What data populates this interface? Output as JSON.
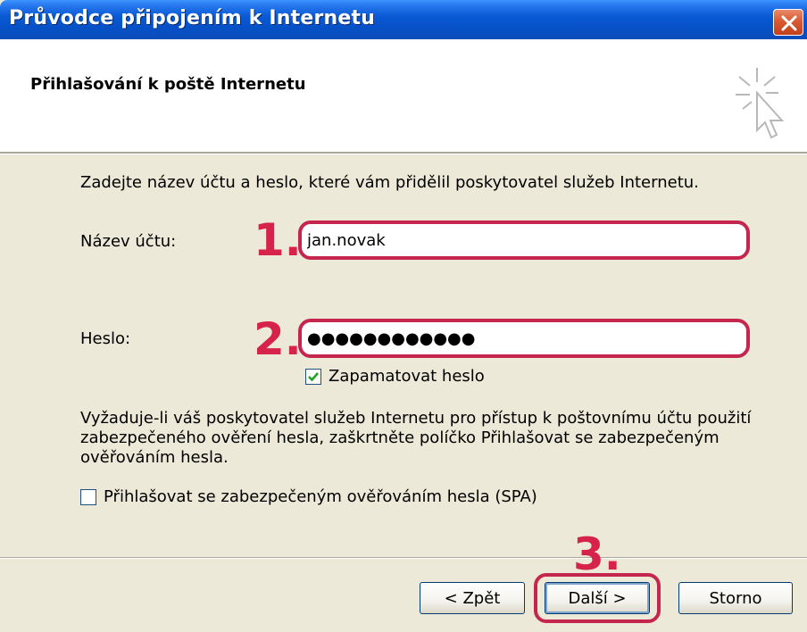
{
  "window": {
    "title": "Průvodce připojením k Internetu"
  },
  "header": {
    "title": "Přihlašování k poště Internetu",
    "icon": "wizard-cursor-icon"
  },
  "form": {
    "intro": "Zadejte název účtu a heslo, které vám přidělil poskytovatel služeb Internetu.",
    "account_label": "Název účtu:",
    "account_value": "jan.novak",
    "password_label": "Heslo:",
    "password_value": "●●●●●●●●●●●●",
    "remember_label": "Zapamatovat heslo",
    "remember_checked": true,
    "note": "Vyžaduje-li váš poskytovatel služeb Internetu pro přístup k poštovnímu účtu použití zabezpečeného ověření hesla, zaškrtněte políčko Přihlašovat se zabezpečeným ověřováním hesla.",
    "spa_label": "Přihlašovat se zabezpečeným ověřováním hesla (SPA)",
    "spa_checked": false
  },
  "annotations": {
    "step1": "1.",
    "step2": "2.",
    "step3": "3.",
    "highlight_color": "#c4264d"
  },
  "buttons": {
    "back": "< Zpět",
    "next": "Další >",
    "cancel": "Storno"
  },
  "colors": {
    "titlebar": "#0a5ad6",
    "dialog_bg": "#ece9d8",
    "close_button": "#d95a32"
  }
}
